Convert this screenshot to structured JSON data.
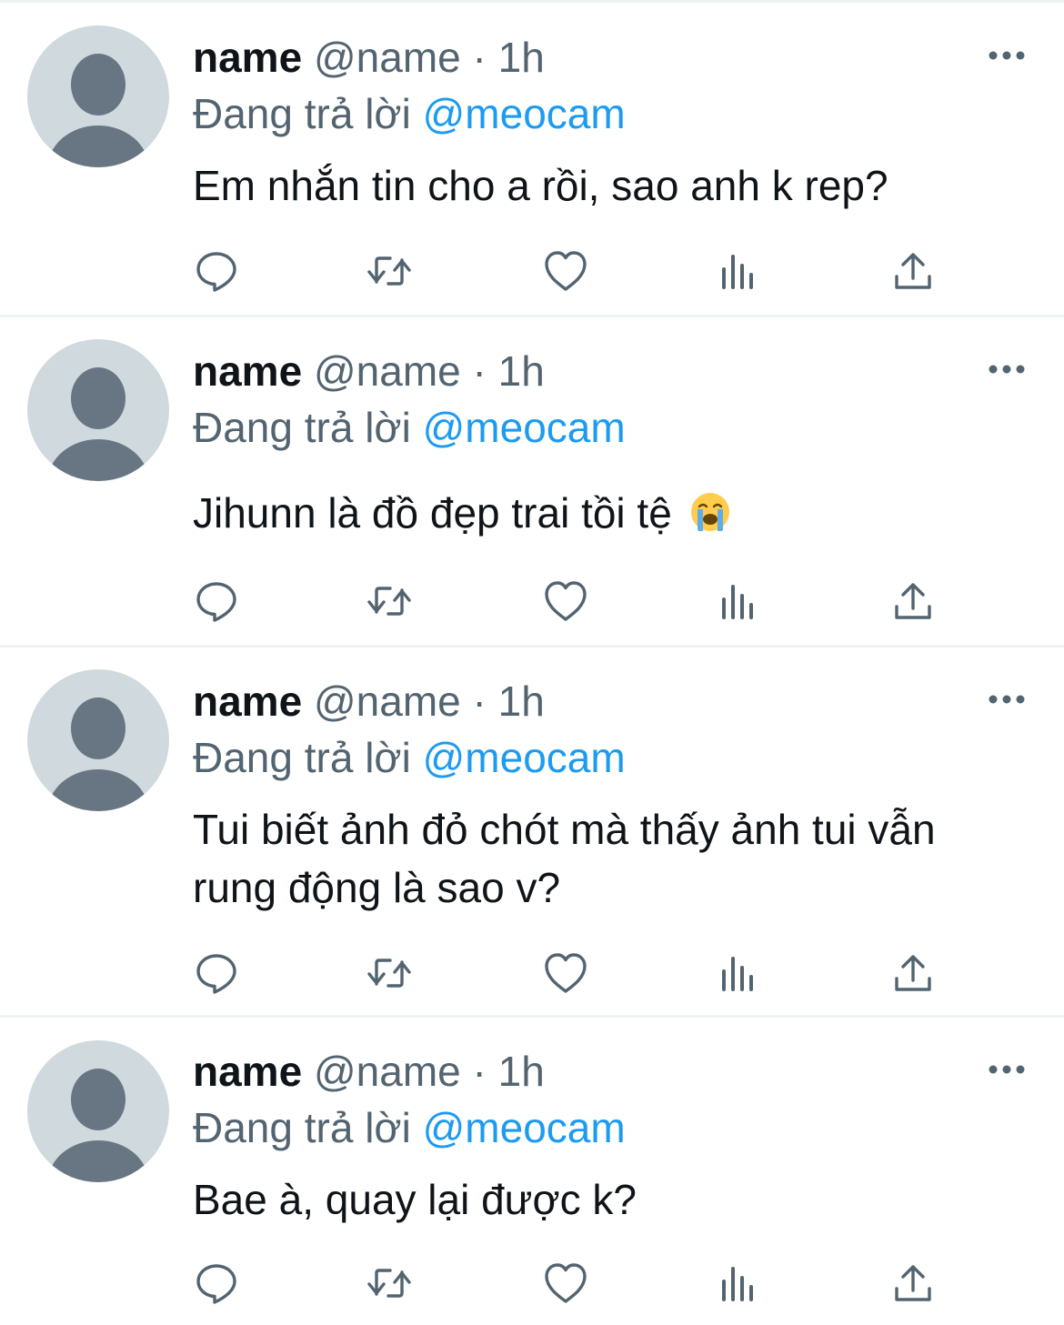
{
  "tweets": [
    {
      "name": "name",
      "handle": "@name",
      "time": "1h",
      "reply_prefix": "Đang trả lời",
      "reply_to": "@meocam",
      "text": "Em nhắn tin cho a rồi, sao anh k rep?"
    },
    {
      "name": "name",
      "handle": "@name",
      "time": "1h",
      "reply_prefix": "Đang trả lời",
      "reply_to": "@meocam",
      "text": "Jihunn là đồ đẹp trai tồi tệ",
      "emoji": "loudly-crying-face"
    },
    {
      "name": "name",
      "handle": "@name",
      "time": "1h",
      "reply_prefix": "Đang trả lời",
      "reply_to": "@meocam",
      "text": "Tui biết ảnh đỏ chót mà thấy ảnh tui vẫn rung động là sao v?"
    },
    {
      "name": "name",
      "handle": "@name",
      "time": "1h",
      "reply_prefix": "Đang trả lời",
      "reply_to": "@meocam",
      "text": "Bae à, quay lại được k?"
    }
  ],
  "separator": "·",
  "icons": {
    "reply": "reply-icon",
    "retweet": "retweet-icon",
    "like": "like-icon",
    "views": "views-icon",
    "share": "share-icon",
    "more": "more-icon"
  },
  "colors": {
    "text": "#0f1419",
    "secondary": "#536471",
    "mention": "#1d9bf0",
    "avatar_bg": "#cfd9de",
    "avatar_fg": "#687684",
    "divider": "#eff3f4"
  }
}
